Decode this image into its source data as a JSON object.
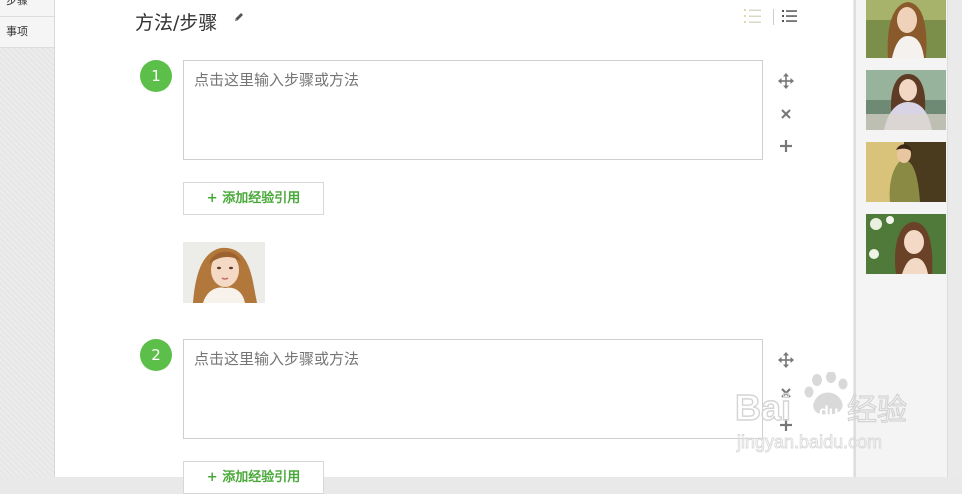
{
  "left_nav": {
    "items": [
      {
        "label": "步骤"
      },
      {
        "label": "事项"
      }
    ]
  },
  "section": {
    "title": "方法/步骤",
    "edit_icon": "pencil-icon",
    "view_icons": [
      "numbered-list-icon",
      "bullet-list-icon"
    ]
  },
  "steps": [
    {
      "number": "1",
      "placeholder": "点击这里输入步骤或方法",
      "tools": [
        "move-icon",
        "close-icon",
        "plus-icon"
      ],
      "ref_button": "+ 添加经验引用",
      "has_image": true
    },
    {
      "number": "2",
      "placeholder": "点击这里输入步骤或方法",
      "tools": [
        "move-icon",
        "close-icon",
        "plus-icon"
      ],
      "ref_button": "+ 添加经验引用"
    }
  ],
  "sidebar": {
    "thumbnails": [
      "photo-1",
      "photo-2",
      "photo-3",
      "photo-4"
    ]
  },
  "watermark": {
    "brand": "Bai",
    "brand2": "du",
    "product": "经验",
    "url": "jingyan.baidu.com"
  },
  "colors": {
    "accent_green": "#5cbf49",
    "button_text_green": "#4aa93a",
    "placeholder_gray": "#bdbdbd",
    "watermark": "#dddddd"
  }
}
